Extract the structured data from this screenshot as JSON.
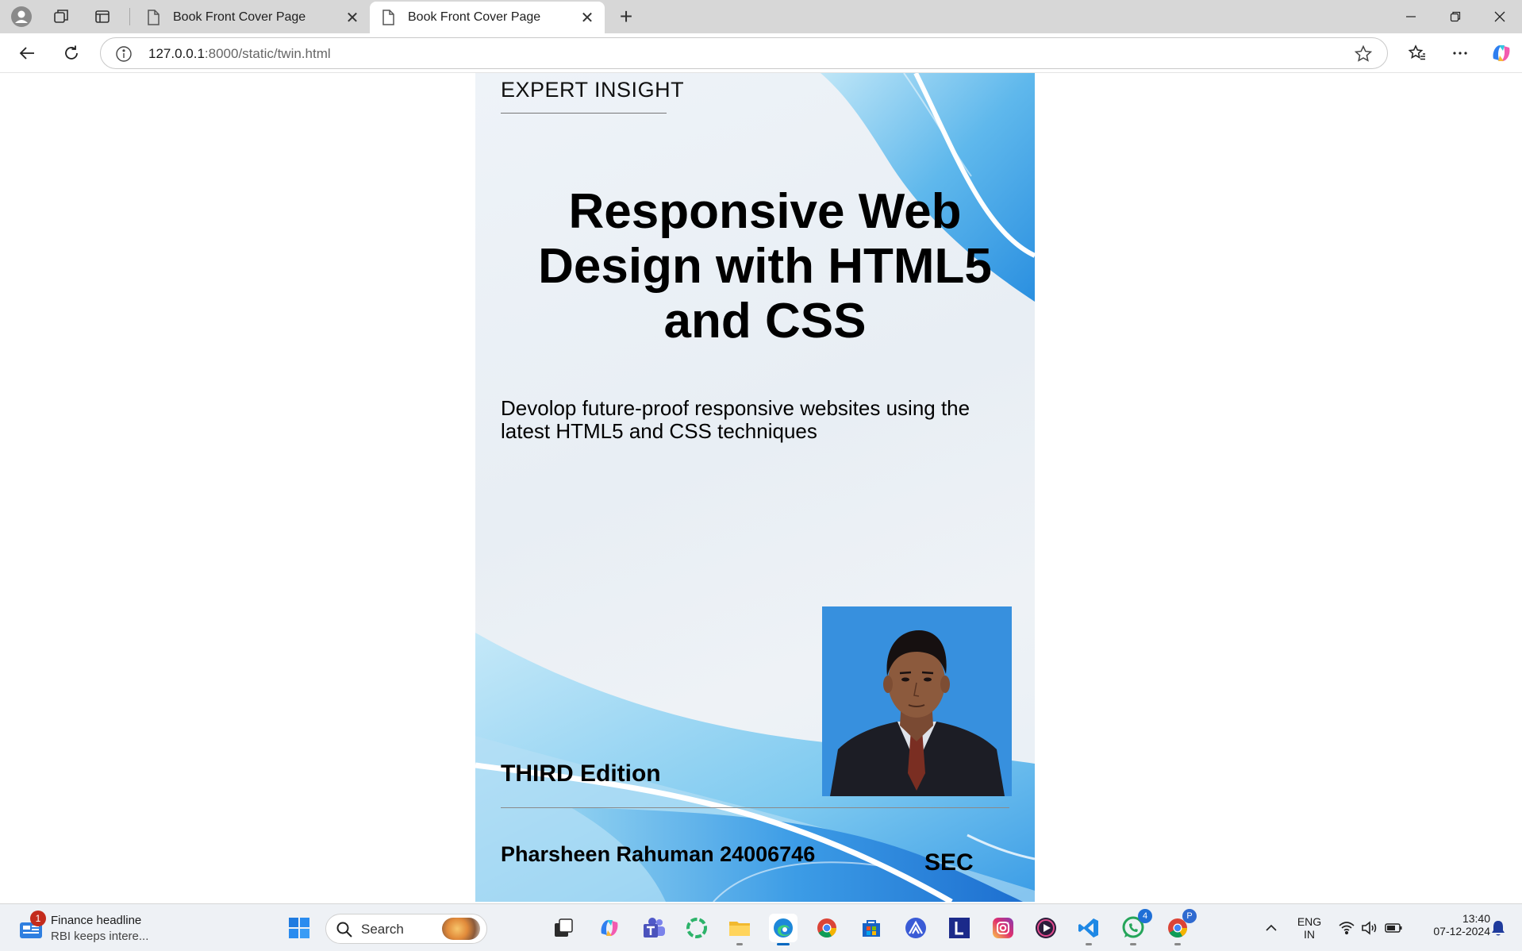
{
  "browser": {
    "tabs": [
      {
        "title": "Book Front Cover Page",
        "active": false
      },
      {
        "title": "Book Front Cover Page",
        "active": true
      }
    ],
    "url_host": "127.0.0.1",
    "url_rest": ":8000/static/twin.html"
  },
  "cover": {
    "series_label": "EXPERT INSIGHT",
    "title": "Responsive Web Design with HTML5 and CSS",
    "subtitle": "Devolop future-proof responsive websites using the latest HTML5 and CSS techniques",
    "edition": "THIRD Edition",
    "author": "Pharsheen Rahuman 24006746",
    "publisher": "SEC"
  },
  "taskbar": {
    "news_badge": "1",
    "news_title": "Finance headline",
    "news_subtitle": "RBI keeps intere...",
    "search_placeholder": "Search",
    "teams_badge": "4",
    "lang_top": "ENG",
    "lang_bottom": "IN",
    "time": "13:40",
    "date": "07-12-2024"
  },
  "colors": {
    "accent": "#0067c0",
    "cover_blue": "#2b8fe0",
    "cover_light_blue": "#8fd0f0"
  }
}
